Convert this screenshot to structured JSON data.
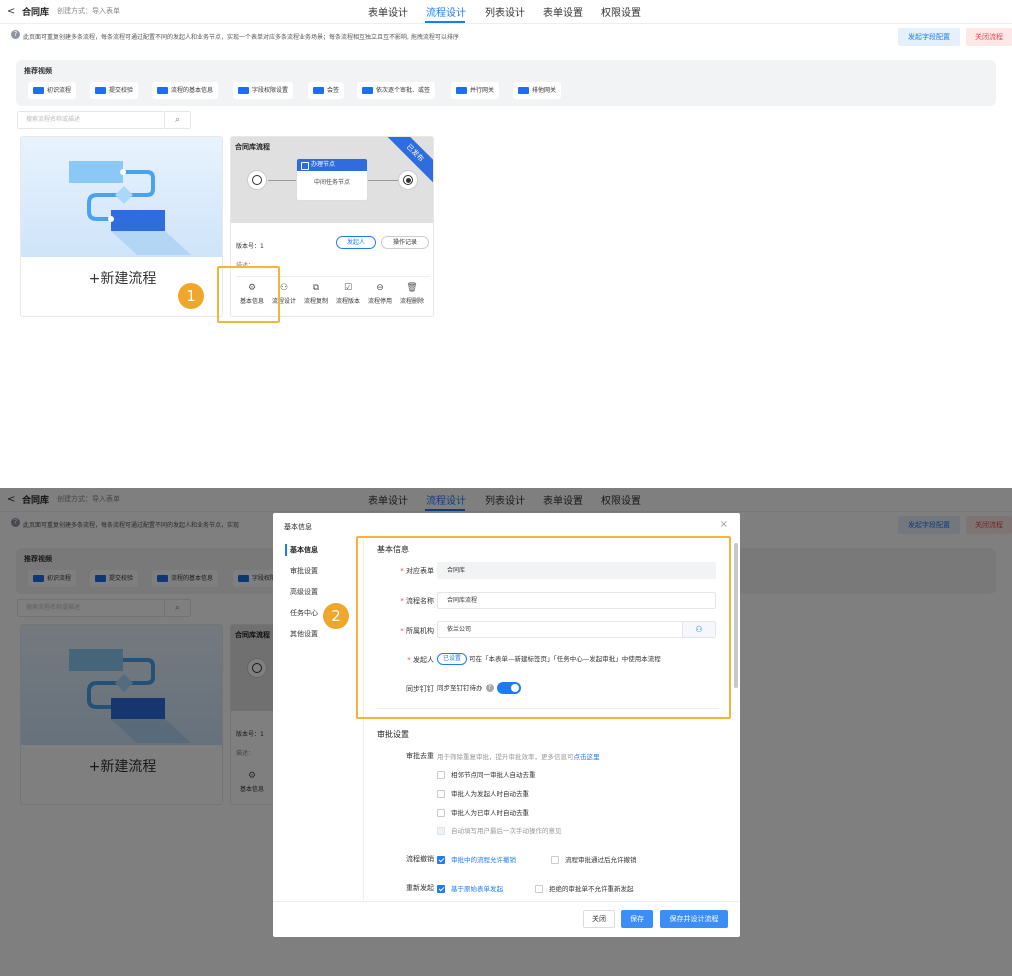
{
  "header": {
    "back": "<",
    "title": "合同库",
    "subtitle": "创建方式：导入表单",
    "tabs": [
      "表单设计",
      "流程设计",
      "列表设计",
      "表单设置",
      "权限设置"
    ],
    "active_tab": "流程设计"
  },
  "notice": {
    "icon": "?",
    "text": "此页面可重复创建多条流程，每条流程可通过配置不同的发起人和业务节点，实现一个表单对应多条流程业务场景；每条流程相互独立且互不影响, 拖拽流程可以排序",
    "text_truncated": "此页面可重复创建多条流程，每条流程可通过配置不同的发起人和业务节点，实现"
  },
  "top_buttons": {
    "config": "发起字段配置",
    "close": "关闭流程"
  },
  "videos": {
    "heading": "推荐视频",
    "items": [
      "初识流程",
      "提交校验",
      "流程的基本信息",
      "字段权限设置",
      "会签",
      "依次逐个审批、或签",
      "并行网关",
      "排他网关"
    ]
  },
  "search": {
    "placeholder": "搜索流程名称或描述",
    "icon": "search-icon"
  },
  "new_card": {
    "label": "+新建流程"
  },
  "flow_card": {
    "name": "合同库流程",
    "ribbon": "已发布",
    "task_title": "办理节点",
    "task_body": "中间任务节点",
    "version": "版本号：1",
    "initiator_btn": "发起人",
    "log_btn": "操作记录",
    "desc": "描述：",
    "actions": [
      {
        "label": "基本信息",
        "icon": "gear-icon",
        "glyph": "⚙"
      },
      {
        "label": "流程设计",
        "icon": "flow-icon",
        "glyph": "⚇"
      },
      {
        "label": "流程复制",
        "icon": "copy-icon",
        "glyph": "⧉"
      },
      {
        "label": "流程版本",
        "icon": "version-icon",
        "glyph": "☑"
      },
      {
        "label": "流程停用",
        "icon": "stop-icon",
        "glyph": "⊖"
      },
      {
        "label": "流程删除",
        "icon": "trash-icon",
        "glyph": "🗑"
      }
    ]
  },
  "markers": {
    "one": "1",
    "two": "2"
  },
  "modal": {
    "title": "基本信息",
    "close": "×",
    "nav": [
      "基本信息",
      "审批设置",
      "高级设置",
      "任务中心",
      "其他设置"
    ],
    "basic": {
      "heading": "基本信息",
      "form_label": "对应表单",
      "form_value": "合同库",
      "name_label": "流程名称",
      "name_value": "合同库流程",
      "org_label": "所属机构",
      "org_value": "依兰公司",
      "initiator_label": "发起人",
      "initiator_pill": "已设置",
      "initiator_text": "可在「本表单—新建标签页」「任务中心—发起审批」中使用本流程",
      "dingtalk_label": "同步钉钉",
      "dingtalk_text": "同步至钉钉待办",
      "dingtalk_on": true
    },
    "approval": {
      "heading": "审批设置",
      "dedupe_label": "审批去重",
      "dedupe_text": "用于筛除重复审批，提升审批效率，更多信息可",
      "dedupe_link": "点击这里",
      "options": [
        {
          "label": "相邻节点同一审批人自动去重",
          "checked": false,
          "disabled": false
        },
        {
          "label": "审批人为发起人时自动去重",
          "checked": false,
          "disabled": false
        },
        {
          "label": "审批人为已审人时自动去重",
          "checked": false,
          "disabled": false
        },
        {
          "label": "自动填写用户最后一次手动操作的意见",
          "checked": false,
          "disabled": true
        }
      ],
      "revoke_label": "流程撤销",
      "revoke_opt1": "审批中的流程允许撤销",
      "revoke_opt2": "流程审批通过后允许撤销",
      "resubmit_label": "重新发起",
      "resubmit_opt1": "基于原始表单发起",
      "resubmit_opt2": "拒绝的审批单不允许重新发起"
    },
    "footer": {
      "close": "关闭",
      "save": "保存",
      "save_design": "保存并设计流程"
    }
  },
  "colors": {
    "accent": "#1e7bf5",
    "highlight": "#f4b43a",
    "badge": "#f0a52b",
    "danger": "#e5484d"
  }
}
